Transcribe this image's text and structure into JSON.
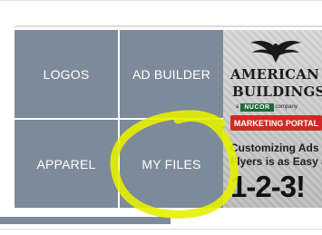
{
  "tiles": {
    "logos": "LOGOS",
    "ad_builder": "AD BUILDER",
    "apparel": "APPAREL",
    "my_files": "MY FILES"
  },
  "ad": {
    "brand_line1": "AMERICAN",
    "brand_line2": "BUILDINGS",
    "nucor_prefix": "a",
    "nucor": "NUCOR",
    "nucor_suffix": "company",
    "portal": "MARKETING PORTAL",
    "tagline1": "Customizing Ads or",
    "tagline2": "Flyers is as Easy as",
    "steps": "1-2-3!"
  },
  "colors": {
    "tile": "#7d8a99",
    "highlight": "#e6ef00",
    "portal_red": "#cf2b22",
    "nucor_green": "#1e6b38"
  }
}
